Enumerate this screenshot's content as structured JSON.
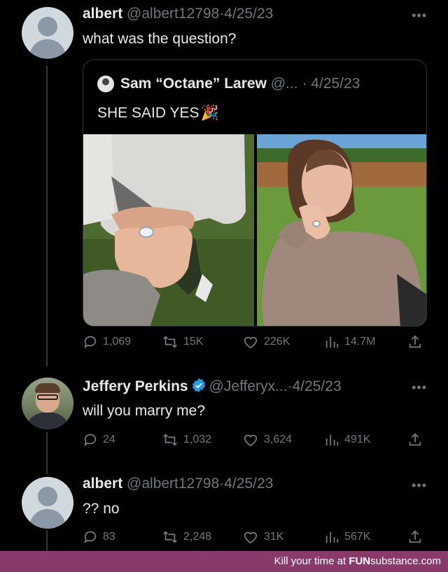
{
  "tweets": [
    {
      "name": "albert",
      "handle": "@albert12798",
      "date": "4/25/23",
      "text": "what was the question?",
      "quote": {
        "name": "Sam “Octane” Larew",
        "handle": "@...",
        "date": "4/25/23",
        "text": "SHE SAID YES",
        "emoji": "🎉",
        "photos": [
          "ring-hand-photo",
          "woman-showing-ring-photo"
        ]
      },
      "actions": {
        "replies": "1,069",
        "retweets": "15K",
        "likes": "226K",
        "views": "14.7M"
      }
    },
    {
      "name": "Jeffery Perkins",
      "handle": "@Jefferyx...",
      "date": "4/25/23",
      "verified": true,
      "text": "will you marry me?",
      "actions": {
        "replies": "24",
        "retweets": "1,032",
        "likes": "3,624",
        "views": "491K"
      }
    },
    {
      "name": "albert",
      "handle": "@albert12798",
      "date": "4/25/23",
      "text": "?? no",
      "actions": {
        "replies": "83",
        "retweets": "2,248",
        "likes": "31K",
        "views": "567K"
      }
    }
  ],
  "more_label": "•••",
  "date_separator": "·",
  "footer": {
    "prefix": "Kill your time at ",
    "brand_fun": "FUN",
    "brand_rest": "substance.com"
  },
  "colors": {
    "background": "#000000",
    "muted": "#71767b",
    "verified": "#1d9bf0",
    "footer": "#8a3a6a"
  }
}
